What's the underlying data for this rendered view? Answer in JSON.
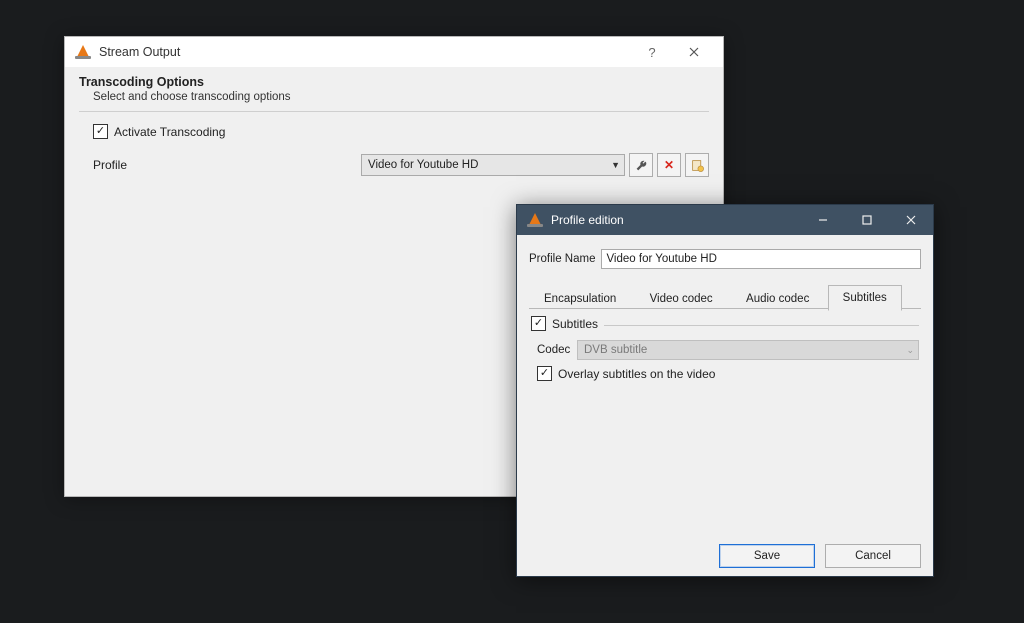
{
  "stream": {
    "title": "Stream Output",
    "section_title": "Transcoding Options",
    "section_sub": "Select and choose transcoding options",
    "activate_label": "Activate Transcoding",
    "profile_label": "Profile",
    "profile_value": "Video for Youtube HD"
  },
  "profile": {
    "title": "Profile edition",
    "name_label": "Profile Name",
    "name_value": "Video for Youtube HD",
    "tabs": {
      "encapsulation": "Encapsulation",
      "video_codec": "Video codec",
      "audio_codec": "Audio codec",
      "subtitles": "Subtitles"
    },
    "subtitles_legend": "Subtitles",
    "codec_label": "Codec",
    "codec_value": "DVB subtitle",
    "overlay_label": "Overlay subtitles on the video",
    "save": "Save",
    "cancel": "Cancel"
  }
}
